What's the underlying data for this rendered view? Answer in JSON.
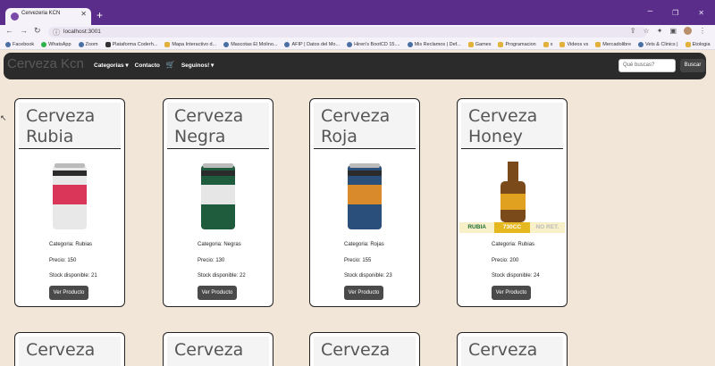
{
  "browser": {
    "tab_title": "Cervezeria KCN",
    "url": "localhost:3001",
    "bookmarks": [
      "Facebook",
      "WhatsApp",
      "Zoom",
      "Plataforma Coderh...",
      "Mapa Interactivo d...",
      "Mascotas El Molino...",
      "AFIP | Datos del Mo...",
      "Hiren's BootCD 15....",
      "Mis Reclamos | Def...",
      "Games",
      "Programacion",
      "x",
      "Videos vs",
      "Mercadolibre",
      "Vets & Clinics |",
      "Etologia"
    ]
  },
  "navbar": {
    "brand": "Cerveza Kcn",
    "links": [
      "Categorías ▾",
      "Contacto",
      "Seguinos! ▾"
    ],
    "search_placeholder": "Qué buscas?",
    "search_button": "Buscar"
  },
  "products": [
    {
      "title": "Cerveza Rubia",
      "category": "Categoria: Rubias",
      "price": "Precio: 150",
      "stock": "Stock disponible: 21",
      "button": "Ver Producto",
      "can_color": "#e8e8e8",
      "accent": "#d9365a"
    },
    {
      "title": "Cerveza Negra",
      "category": "Categoria: Negras",
      "price": "Precio: 130",
      "stock": "Stock disponible: 22",
      "button": "Ver Producto",
      "can_color": "#1f5c3d",
      "accent": "#e6e6e6"
    },
    {
      "title": "Cerveza Roja",
      "category": "Categoria: Rojas",
      "price": "Precio: 155",
      "stock": "Stock disponible: 23",
      "button": "Ver Producto",
      "can_color": "#2a4f7a",
      "accent": "#d98a2b"
    },
    {
      "title": "Cerveza Honey",
      "category": "Categoria: Rubias",
      "price": "Precio: 200",
      "stock": "Stock disponible: 24",
      "button": "Ver Producto",
      "can_color": "#7a4a1a",
      "accent": "#e0a020",
      "label": {
        "left": "RUBIA",
        "mid": "730CC",
        "right": "NO RET."
      }
    }
  ],
  "partial_cards": [
    "Cerveza",
    "Cerveza",
    "Cerveza",
    "Cerveza"
  ]
}
